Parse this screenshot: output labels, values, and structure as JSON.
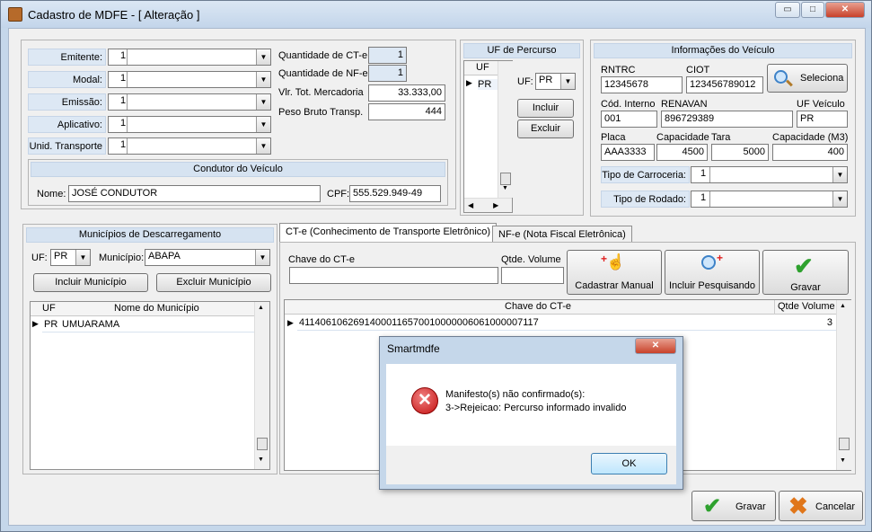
{
  "window": {
    "title": "Cadastro de MDFE - [ Alteração ]",
    "minimize_icon": "▭",
    "maximize_icon": "□",
    "close_icon": "✕"
  },
  "top": {
    "emitente": {
      "label": "Emitente:",
      "value": "1"
    },
    "modal": {
      "label": "Modal:",
      "value": "1"
    },
    "emissao": {
      "label": "Emissão:",
      "value": "1"
    },
    "aplicativo": {
      "label": "Aplicativo:",
      "value": "1"
    },
    "unid_transporte": {
      "label": "Unid. Transporte",
      "value": "1"
    },
    "qtd_cte": {
      "label": "Quantidade de CT-e",
      "value": "1"
    },
    "qtd_nfe": {
      "label": "Quantidade de NF-e",
      "value": "1"
    },
    "vlr_tot": {
      "label": "Vlr. Tot. Mercadoria",
      "value": "33.333,00"
    },
    "peso_bruto": {
      "label": "Peso Bruto Transp.",
      "value": "444"
    },
    "condutor": {
      "header": "Condutor do Veículo",
      "nome_label": "Nome:",
      "nome_value": "JOSÉ CONDUTOR",
      "cpf_label": "CPF:",
      "cpf_value": "555.529.949-49"
    }
  },
  "percurso": {
    "header": "UF de Percurso",
    "col": "UF",
    "rows": [
      "PR"
    ],
    "uf_label": "UF:",
    "uf_value": "PR",
    "incluir": "Incluir",
    "excluir": "Excluir"
  },
  "veiculo": {
    "header": "Informações do Veículo",
    "rntrc_label": "RNTRC",
    "rntrc": "12345678",
    "ciot_label": "CIOT",
    "ciot": "123456789012",
    "seleciona": "Seleciona",
    "cod_label": "Cód. Interno",
    "cod": "001",
    "renavan_label": "RENAVAN",
    "renavan": "896729389",
    "ufv_label": "UF Veículo",
    "ufv": "PR",
    "placa_label": "Placa",
    "placa": "AAA3333",
    "capacidade_label": "Capacidade",
    "capacidade": "4500",
    "tara_label": "Tara",
    "tara": "5000",
    "cap_m3_label": "Capacidade (M3)",
    "cap_m3": "400",
    "carroceria_label": "Tipo de Carroceria:",
    "carroceria": "1",
    "rodado_label": "Tipo de Rodado:",
    "rodado": "1"
  },
  "municipios": {
    "header": "Municípios de Descarregamento",
    "uf_label": "UF:",
    "uf_value": "PR",
    "mun_label": "Município:",
    "mun_value": "ABAPA",
    "incluir": "Incluir Município",
    "excluir": "Excluir Município",
    "col_uf": "UF",
    "col_nome": "Nome do Município",
    "rows": [
      {
        "uf": "PR",
        "nome": "UMUARAMA"
      }
    ]
  },
  "docs": {
    "tab_cte": "CT-e (Conhecimento de Transporte Eletrônico)",
    "tab_nfe": "NF-e (Nota Fiscal Eletrônica)",
    "chave_label": "Chave do CT-e",
    "qtde_label": "Qtde. Volume",
    "cadastrar": "Cadastrar Manual",
    "incluir_pesq": "Incluir Pesquisando",
    "gravar": "Gravar",
    "col_chave": "Chave do CT-e",
    "col_qtde": "Qtde Volume",
    "rows": [
      {
        "chave": "41140610626914000116570010000006061000007117",
        "qtde": "3"
      }
    ]
  },
  "footer": {
    "gravar": "Gravar",
    "cancelar": "Cancelar"
  },
  "dialog": {
    "title": "Smartmdfe",
    "line1": "Manifesto(s) não confirmado(s):",
    "line2": "3->Rejeicao: Percurso informado invalido",
    "ok": "OK",
    "close_icon": "✕"
  }
}
